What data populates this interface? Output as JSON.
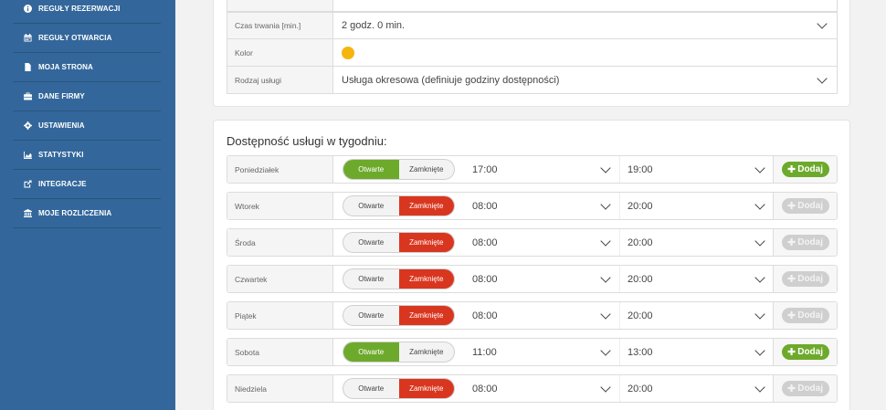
{
  "sidebar": {
    "items": [
      {
        "label": "REGUŁY REZERWACJI",
        "icon": "info-circle-icon"
      },
      {
        "label": "REGUŁY OTWARCIA",
        "icon": "calendar-icon"
      },
      {
        "label": "MOJA STRONA",
        "icon": "file-icon"
      },
      {
        "label": "DANE FIRMY",
        "icon": "briefcase-icon"
      },
      {
        "label": "USTAWIENIA",
        "icon": "gear-icon"
      },
      {
        "label": "STATYSTYKI",
        "icon": "area-chart-icon"
      },
      {
        "label": "INTEGRACJE",
        "icon": "external-link-icon"
      },
      {
        "label": "MOJE ROZLICZENIA",
        "icon": "bank-icon"
      }
    ]
  },
  "service_form": {
    "duration": {
      "label": "Czas trwania [min.]",
      "value": "2 godz. 0 min."
    },
    "color": {
      "label": "Kolor",
      "value": "#f5b50f"
    },
    "type": {
      "label": "Rodzaj usługi",
      "value": "Usługa okresowa (definiuje godziny dostępności)"
    }
  },
  "availability": {
    "title": "Dostępność usługi w tygodniu:",
    "open_label": "Otwarte",
    "closed_label": "Zamknięte",
    "add_label": "Dodaj",
    "days": [
      {
        "name": "Poniedziałek",
        "state": "open",
        "from": "17:00",
        "to": "19:00"
      },
      {
        "name": "Wtorek",
        "state": "closed",
        "from": "08:00",
        "to": "20:00"
      },
      {
        "name": "Środa",
        "state": "closed",
        "from": "08:00",
        "to": "20:00"
      },
      {
        "name": "Czwartek",
        "state": "closed",
        "from": "08:00",
        "to": "20:00"
      },
      {
        "name": "Piątek",
        "state": "closed",
        "from": "08:00",
        "to": "20:00"
      },
      {
        "name": "Sobota",
        "state": "open",
        "from": "11:00",
        "to": "13:00"
      },
      {
        "name": "Niedziela",
        "state": "closed",
        "from": "08:00",
        "to": "20:00"
      }
    ]
  },
  "colors": {
    "sidebar": "#33679b",
    "open": "#6daa2c",
    "closed": "#d9361f",
    "disabled": "#cfcfcf"
  }
}
